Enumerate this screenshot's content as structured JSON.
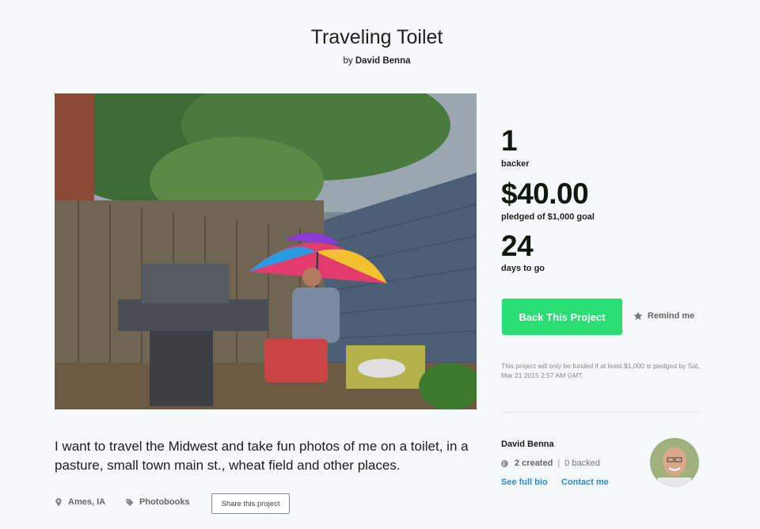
{
  "project": {
    "title": "Traveling Toilet",
    "by_prefix": "by",
    "creator": "David Benna",
    "blurb": "I want to travel the Midwest and take fun photos of me on a toilet, in a pasture, small town main st., wheat field and other places."
  },
  "stats": {
    "backers": "1",
    "backers_label": "backer",
    "pledged": "$40.00",
    "pledged_label": "pledged of $1,000 goal",
    "days": "24",
    "days_label": "days to go"
  },
  "actions": {
    "back_label": "Back This Project",
    "remind_label": "Remind me",
    "share_label": "Share this project"
  },
  "funding_note": "This project will only be funded if at least $1,000 is pledged by Sat, Mar 21 2015 2:57 AM GMT.",
  "meta": {
    "location": "Ames, IA",
    "category": "Photobooks"
  },
  "creator_card": {
    "name": "David Benna",
    "created": "2 created",
    "separator": "|",
    "backed": "0 backed",
    "full_bio": "See full bio",
    "contact": "Contact me"
  },
  "colors": {
    "accent": "#2bde73",
    "link": "#2a8bd8",
    "background": "#f6f9f9"
  },
  "icons": {
    "location": "map-pin-icon",
    "category": "tag-icon",
    "remind": "star-icon",
    "creator_stats": "kickstarter-icon"
  }
}
